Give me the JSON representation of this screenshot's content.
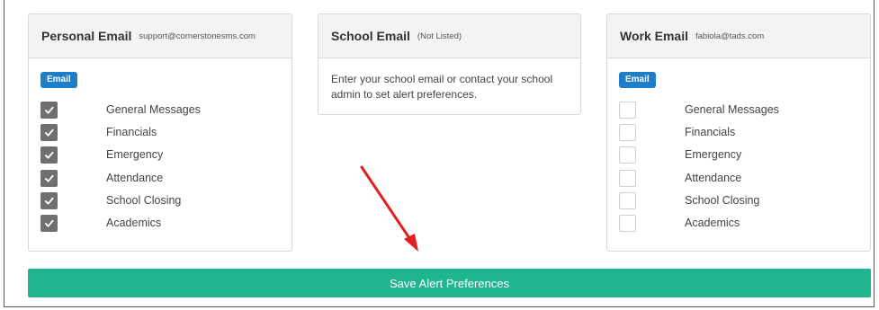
{
  "cards": [
    {
      "title": "Personal Email",
      "subtitle": "support@cornerstonesms.com",
      "badge": "Email",
      "items": [
        {
          "label": "General Messages",
          "checked": true
        },
        {
          "label": "Financials",
          "checked": true
        },
        {
          "label": "Emergency",
          "checked": true
        },
        {
          "label": "Attendance",
          "checked": true
        },
        {
          "label": "School Closing",
          "checked": true
        },
        {
          "label": "Academics",
          "checked": true
        }
      ]
    },
    {
      "title": "School Email",
      "subtitle": "(Not Listed)",
      "message": "Enter your school email or contact your school admin to set alert preferences."
    },
    {
      "title": "Work Email",
      "subtitle": "fabiola@tads.com",
      "badge": "Email",
      "items": [
        {
          "label": "General Messages",
          "checked": false
        },
        {
          "label": "Financials",
          "checked": false
        },
        {
          "label": "Emergency",
          "checked": false
        },
        {
          "label": "Attendance",
          "checked": false
        },
        {
          "label": "School Closing",
          "checked": false
        },
        {
          "label": "Academics",
          "checked": false
        }
      ]
    }
  ],
  "save_button": {
    "label": "Save Alert Preferences"
  },
  "colors": {
    "accent": "#1fb58f",
    "badge": "#1f7ec8",
    "checked_box": "#6f6f6f",
    "annotation_arrow": "#e02020"
  }
}
